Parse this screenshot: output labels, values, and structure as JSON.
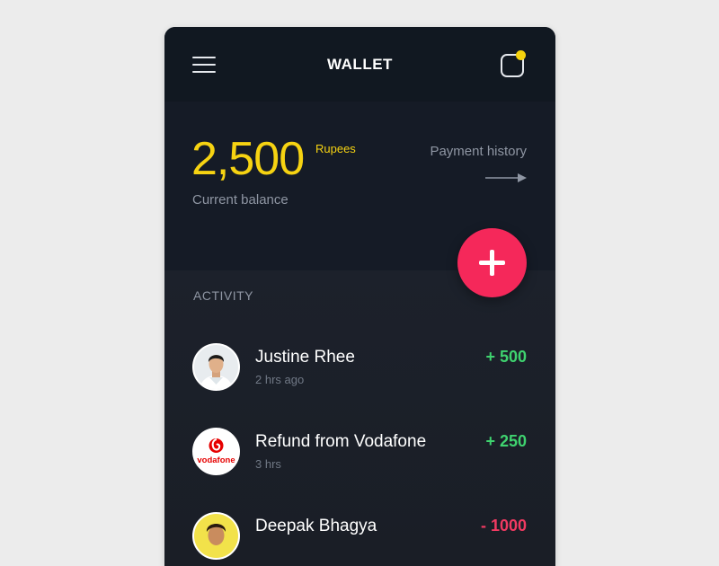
{
  "header": {
    "title": "WALLET",
    "menu_icon": "hamburger-menu-icon",
    "notification_icon": "notification-icon",
    "notification_dot_color": "#f5d20d"
  },
  "balance": {
    "amount": "2,500",
    "unit": "Rupees",
    "label": "Current balance",
    "history_link": "Payment history",
    "amount_color": "#f6d312"
  },
  "fab": {
    "icon": "plus-icon",
    "color": "#f5285a"
  },
  "activity": {
    "heading": "ACTIVITY",
    "items": [
      {
        "name": "Justine Rhee",
        "time": "2 hrs ago",
        "amount": "+ 500",
        "type": "credit",
        "avatar": "person-avatar"
      },
      {
        "name": "Refund from Vodafone",
        "time": "3 hrs",
        "amount": "+ 250",
        "type": "credit",
        "avatar": "vodafone-logo",
        "logo_text": "vodafone"
      },
      {
        "name": "Deepak Bhagya",
        "time": "",
        "amount": "- 1000",
        "type": "debit",
        "avatar": "person-avatar"
      }
    ]
  },
  "colors": {
    "credit": "#3fd36f",
    "debit": "#f23a62"
  }
}
